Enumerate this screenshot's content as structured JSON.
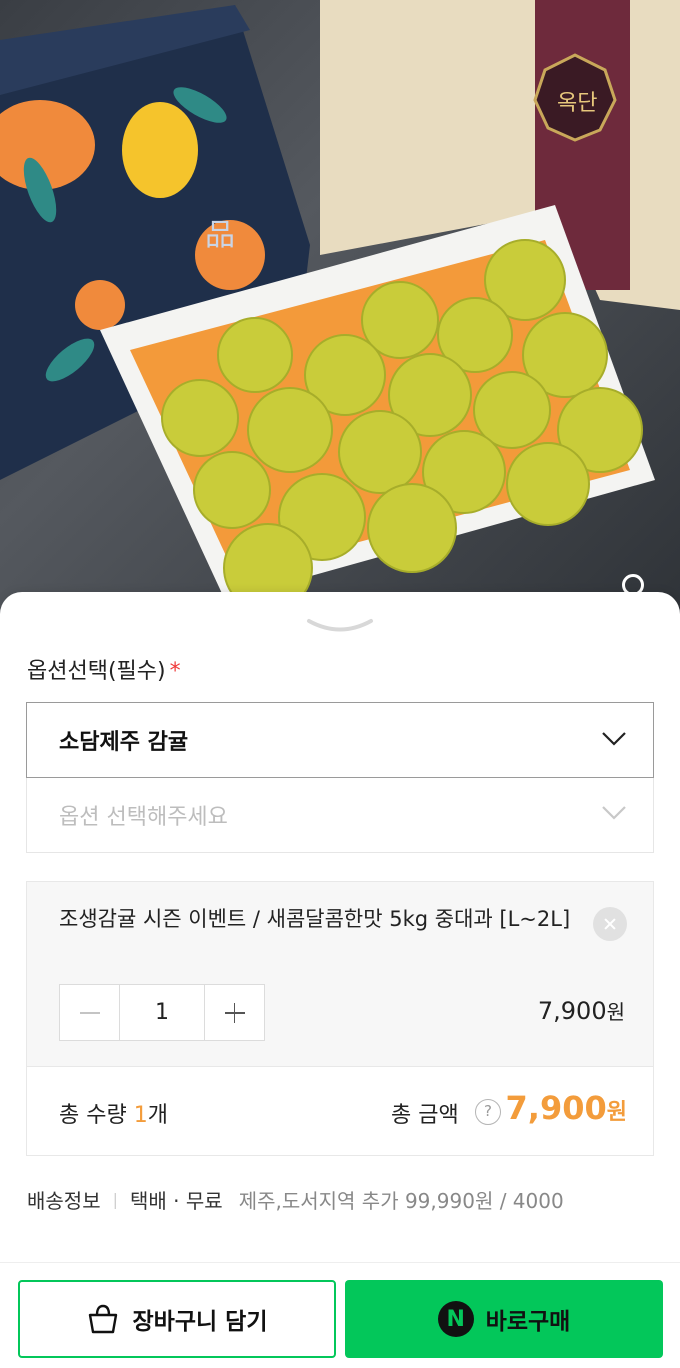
{
  "product_image": {
    "alt": "Jeju tangerine gift box",
    "box_text": "品",
    "gift_box_seal": "옥단"
  },
  "options": {
    "label": "옵션선택(필수)",
    "required_mark": "*",
    "selected_option": "소담제주 감귤",
    "second_placeholder": "옵션 선택해주세요"
  },
  "cart_item": {
    "name": "조생감귤 시즌 이벤트 / 새콤달콤한맛 5kg 중대과 [L~2L]",
    "quantity": "1",
    "price": "7,900",
    "currency": "원"
  },
  "totals": {
    "qty_label": "총 수량",
    "qty_value": "1",
    "qty_unit": "개",
    "amount_label": "총 금액",
    "help_glyph": "?",
    "amount_value": "7,900",
    "currency": "원"
  },
  "shipping": {
    "label": "배송정보",
    "separator": "|",
    "method": "택배 · 무료",
    "extra": "제주,도서지역 추가 99,990원 / 4000"
  },
  "actions": {
    "cart_label": "장바구니 담기",
    "buy_label": "바로구매",
    "npay_glyph": "N"
  },
  "colors": {
    "accent_green": "#03c75a",
    "price_orange": "#f39c3b",
    "required_red": "#ef3a3a"
  }
}
